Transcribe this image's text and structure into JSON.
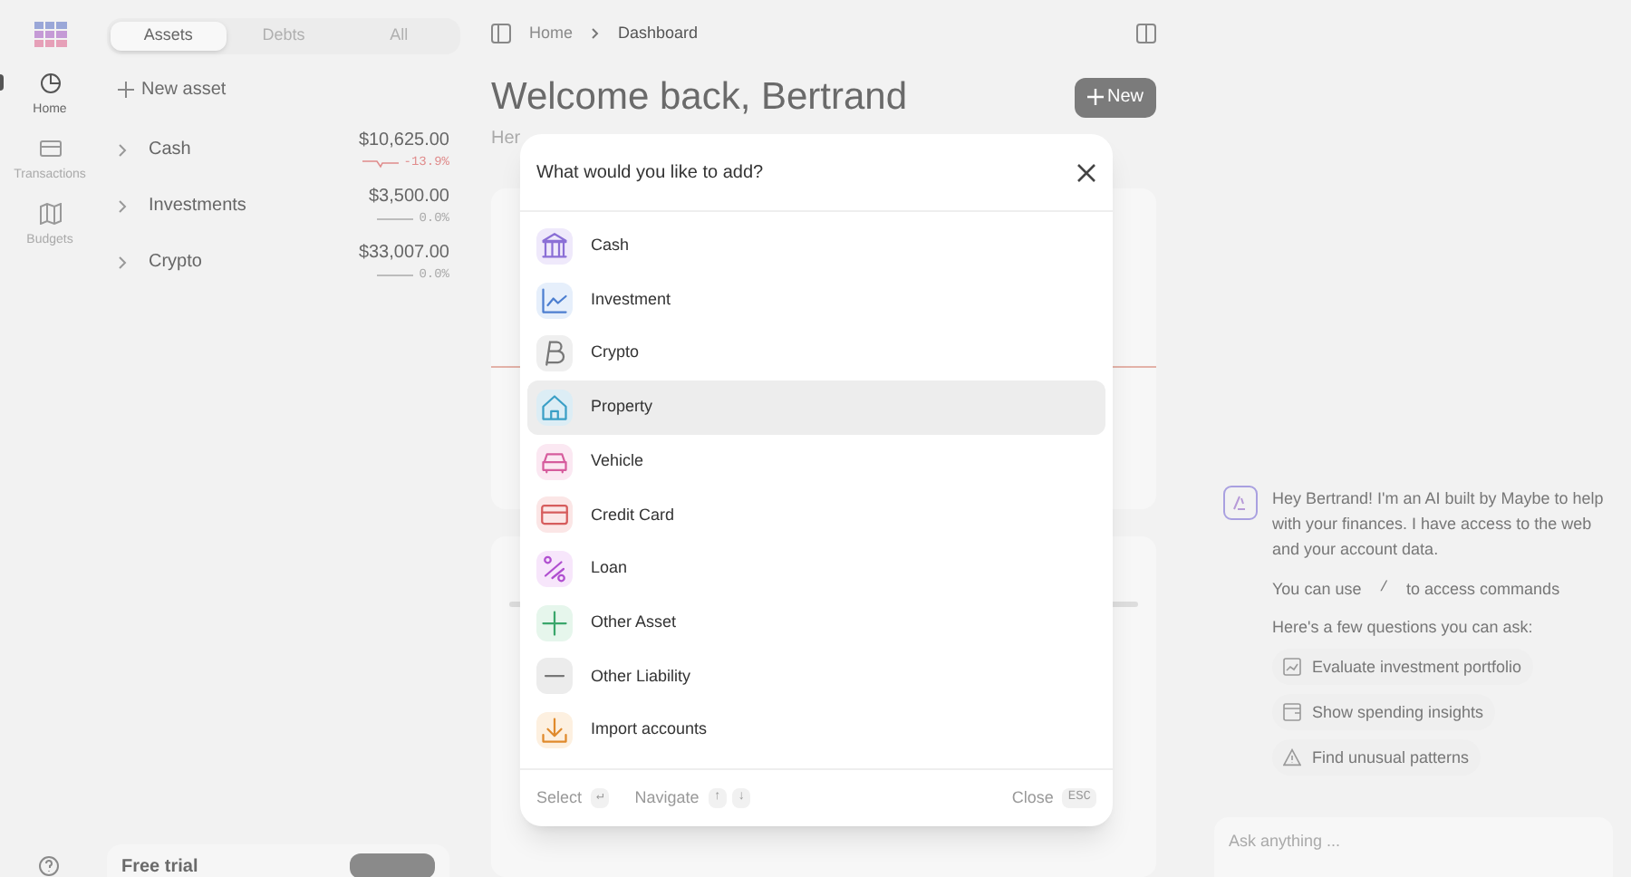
{
  "nav": [
    {
      "label": "Home",
      "selected": true
    },
    {
      "label": "Transactions",
      "selected": false
    },
    {
      "label": "Budgets",
      "selected": false
    }
  ],
  "account_tabs": [
    {
      "label": "Assets",
      "selected": true
    },
    {
      "label": "Debts",
      "selected": false
    },
    {
      "label": "All",
      "selected": false
    }
  ],
  "new_asset": "New asset",
  "accounts": [
    {
      "name": "Cash",
      "amount": "$10,625.00",
      "change": "-13.9%",
      "kind": "down"
    },
    {
      "name": "Investments",
      "amount": "$3,500.00",
      "change": "0.0%",
      "kind": "flat"
    },
    {
      "name": "Crypto",
      "amount": "$33,007.00",
      "change": "0.0%",
      "kind": "flat"
    }
  ],
  "free_trial": {
    "title": "Free trial"
  },
  "breadcrumb": [
    "Home",
    "Dashboard"
  ],
  "page_title": "Welcome back, Bertrand",
  "subtitle_visible": "Her",
  "new_button": "New",
  "modal": {
    "title": "What would you like to add?",
    "items": [
      {
        "label": "Cash",
        "kind": "cash",
        "selected": false
      },
      {
        "label": "Investment",
        "kind": "investment",
        "selected": false
      },
      {
        "label": "Crypto",
        "kind": "crypto",
        "selected": false
      },
      {
        "label": "Property",
        "kind": "property",
        "selected": true
      },
      {
        "label": "Vehicle",
        "kind": "vehicle",
        "selected": false
      },
      {
        "label": "Credit Card",
        "kind": "card",
        "selected": false
      },
      {
        "label": "Loan",
        "kind": "loan",
        "selected": false
      },
      {
        "label": "Other Asset",
        "kind": "asset",
        "selected": false
      },
      {
        "label": "Other Liability",
        "kind": "liability",
        "selected": false
      },
      {
        "label": "Import accounts",
        "kind": "import",
        "selected": false
      }
    ],
    "footer": {
      "select": "Select",
      "select_key": "↵",
      "navigate": "Navigate",
      "nav_keys": [
        "↑",
        "↓"
      ],
      "close": "Close",
      "close_key": "ESC"
    }
  },
  "chat": {
    "intro": "Hey Bertrand! I'm an AI built by Maybe to help with your finances. I have access to the web and your account data.",
    "commands_before": "You can use",
    "commands_key": "/",
    "commands_after": "to access commands",
    "questions_label": "Here's a few questions you can ask:",
    "suggestions": [
      {
        "label": "Evaluate investment portfolio"
      },
      {
        "label": "Show spending insights"
      },
      {
        "label": "Find unusual patterns"
      }
    ],
    "input": {
      "placeholder": "Ask anything ..."
    }
  }
}
